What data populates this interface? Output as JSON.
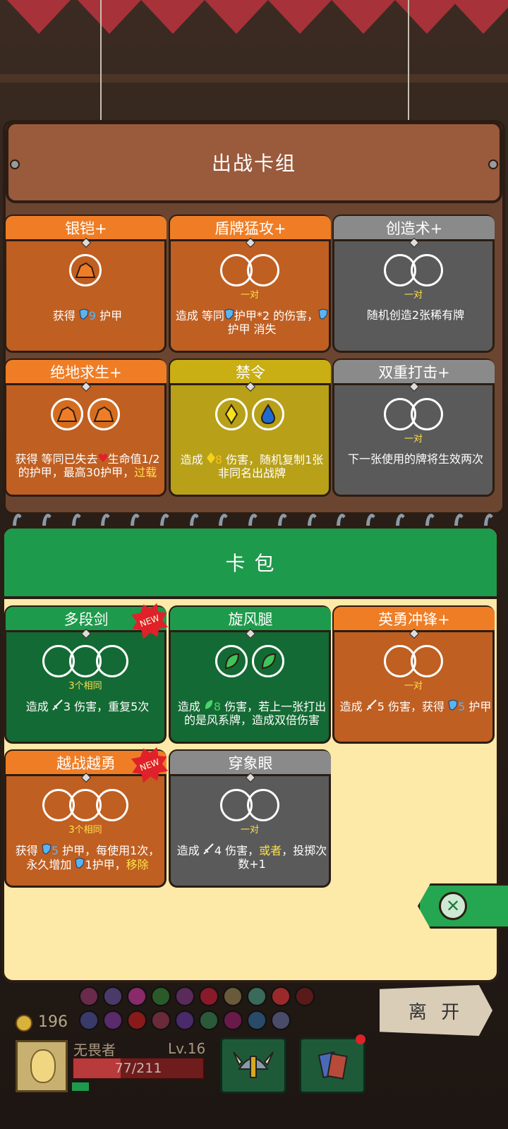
{
  "deck": {
    "title": "出战卡组",
    "cards": [
      {
        "name": "银铠+",
        "color": "orange",
        "subtitle": "",
        "desc": [
          "获得 ",
          {
            "icon": "shield",
            "text": "9"
          },
          " 护甲"
        ]
      },
      {
        "name": "盾牌猛攻+",
        "color": "orange",
        "subtitle": "一对",
        "desc": [
          "造成 等同",
          {
            "icon": "shield",
            "text": ""
          },
          "护甲*2 的伤害，",
          {
            "icon": "shield",
            "text": ""
          },
          "护甲 消失"
        ]
      },
      {
        "name": "创造术+",
        "color": "gray",
        "subtitle": "一对",
        "desc": [
          "随机创造2张稀有牌"
        ]
      },
      {
        "name": "绝地求生+",
        "color": "orange",
        "subtitle": "",
        "desc": [
          "获得 等同已失去",
          {
            "icon": "heart",
            "text": ""
          },
          "生命值1/2 的护甲，最高30护甲，",
          {
            "hl": "过载"
          }
        ]
      },
      {
        "name": "禁令",
        "color": "gold",
        "subtitle": "",
        "desc": [
          "造成 ",
          {
            "icon": "diamond",
            "text": "8"
          },
          " 伤害，随机复制1张非同名出战牌"
        ]
      },
      {
        "name": "双重打击+",
        "color": "gray",
        "subtitle": "一对",
        "desc": [
          "下一张使用的牌将生效两次"
        ]
      }
    ]
  },
  "pack": {
    "title": "卡 包",
    "cards": [
      {
        "name": "多段剑",
        "color": "green",
        "subtitle": "3个相同",
        "new": true,
        "desc": [
          "造成 ",
          {
            "icon": "sword",
            "text": "3"
          },
          " 伤害，重复5次"
        ]
      },
      {
        "name": "旋风腿",
        "color": "green",
        "subtitle": "",
        "desc": [
          "造成 ",
          {
            "icon": "leaf",
            "text": "8"
          },
          " 伤害，若上一张打出的是风系牌，造成双倍伤害"
        ]
      },
      {
        "name": "英勇冲锋+",
        "color": "orange",
        "subtitle": "一对",
        "desc": [
          "造成 ",
          {
            "icon": "sword",
            "text": "5"
          },
          " 伤害，获得 ",
          {
            "icon": "shield",
            "text": "5"
          },
          " 护甲"
        ]
      },
      {
        "name": "越战越勇",
        "color": "orange",
        "subtitle": "3个相同",
        "new": true,
        "desc": [
          "获得 ",
          {
            "icon": "shield",
            "text": "5"
          },
          " 护甲，每使用1次，永久增加 ",
          {
            "icon": "shield",
            "text": ""
          },
          "1护甲，",
          {
            "hl": "移除"
          }
        ]
      },
      {
        "name": "穿象眼",
        "color": "gray",
        "subtitle": "一对",
        "desc": [
          "造成 ",
          {
            "icon": "sword",
            "text": "4"
          },
          " 伤害，",
          {
            "hl": "或者"
          },
          "，投掷次数+1"
        ]
      }
    ],
    "new_label": "NEW"
  },
  "player": {
    "gold": "196",
    "name": "无畏者",
    "level": "Lv.16",
    "hp_text": "77/211",
    "hp_fraction": 0.365
  },
  "leave_label": "离 开"
}
